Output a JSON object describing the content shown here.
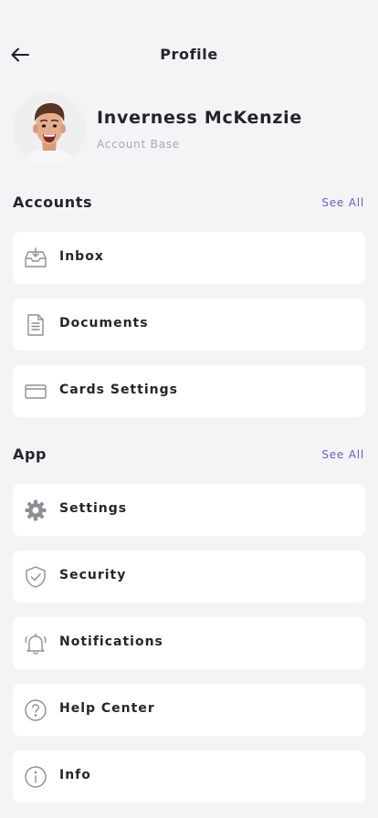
{
  "header": {
    "title": "Profile",
    "back_icon": "arrow-left-icon"
  },
  "profile": {
    "name": "Inverness McKenzie",
    "subtitle": "Account Base",
    "avatar": "avatar-photo"
  },
  "accounts": {
    "title": "Accounts",
    "see_all": "See All",
    "items": [
      {
        "label": "Inbox",
        "icon": "inbox-icon"
      },
      {
        "label": "Documents",
        "icon": "document-icon"
      },
      {
        "label": "Cards Settings",
        "icon": "credit-card-icon"
      }
    ]
  },
  "app": {
    "title": "App",
    "see_all": "See All",
    "items": [
      {
        "label": "Settings",
        "icon": "gear-icon"
      },
      {
        "label": "Security",
        "icon": "shield-icon"
      },
      {
        "label": "Notifications",
        "icon": "bell-icon"
      },
      {
        "label": "Help Center",
        "icon": "help-icon"
      },
      {
        "label": "Info",
        "icon": "info-icon"
      }
    ]
  },
  "colors": {
    "background": "#f4f4f6",
    "card": "#ffffff",
    "accent": "#6b5bd2",
    "icon": "#8e8e96"
  }
}
